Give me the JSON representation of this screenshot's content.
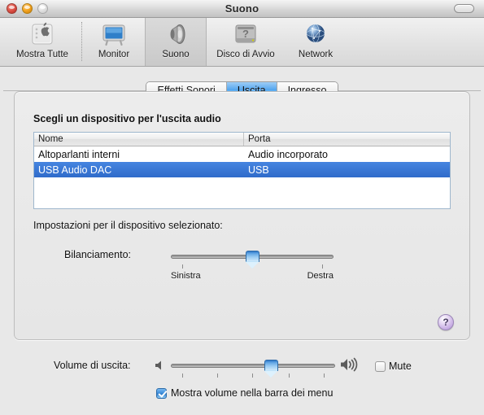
{
  "window": {
    "title": "Suono",
    "controls": {
      "close": "close-button",
      "minimize": "minimize-button",
      "zoom": "zoom-button",
      "toolbar_toggle": "toolbar-toggle-button"
    }
  },
  "toolbar": {
    "items": [
      {
        "label": "Mostra Tutte",
        "icon": "show-all-icon",
        "selected": false
      },
      {
        "label": "Monitor",
        "icon": "display-icon",
        "selected": false
      },
      {
        "label": "Suono",
        "icon": "speaker-icon",
        "selected": true
      },
      {
        "label": "Disco di Avvio",
        "icon": "startup-disk-icon",
        "selected": false
      },
      {
        "label": "Network",
        "icon": "network-globe-icon",
        "selected": false
      }
    ]
  },
  "tabs": [
    {
      "label": "Effetti Sonori",
      "active": false
    },
    {
      "label": "Uscita",
      "active": true
    },
    {
      "label": "Ingresso",
      "active": false
    }
  ],
  "panel": {
    "heading": "Scegli un dispositivo per l'uscita audio",
    "table": {
      "columns": [
        "Nome",
        "Porta"
      ],
      "rows": [
        {
          "name": "Altoparlanti interni",
          "port": "Audio incorporato",
          "selected": false
        },
        {
          "name": "USB Audio DAC",
          "port": "USB",
          "selected": true
        }
      ]
    },
    "settings_label": "Impostazioni per il dispositivo selezionato:",
    "balance": {
      "label": "Bilanciamento:",
      "left_label": "Sinistra",
      "right_label": "Destra",
      "value_percent": 50,
      "tick_count": 2
    },
    "help": {
      "glyph": "?",
      "name": "help-button"
    }
  },
  "bottom": {
    "volume_label": "Volume di uscita:",
    "volume_percent": 60,
    "volume_ticks": 5,
    "mute": {
      "label": "Mute",
      "checked": false
    },
    "show_in_menubar": {
      "label": "Mostra volume nella barra dei menu",
      "checked": true
    }
  },
  "colors": {
    "selection_blue": "#3b77d4",
    "tab_active_blue": "#4fa3ee",
    "help_purple": "#c8aee4",
    "window_bg": "#e8e8e8"
  }
}
